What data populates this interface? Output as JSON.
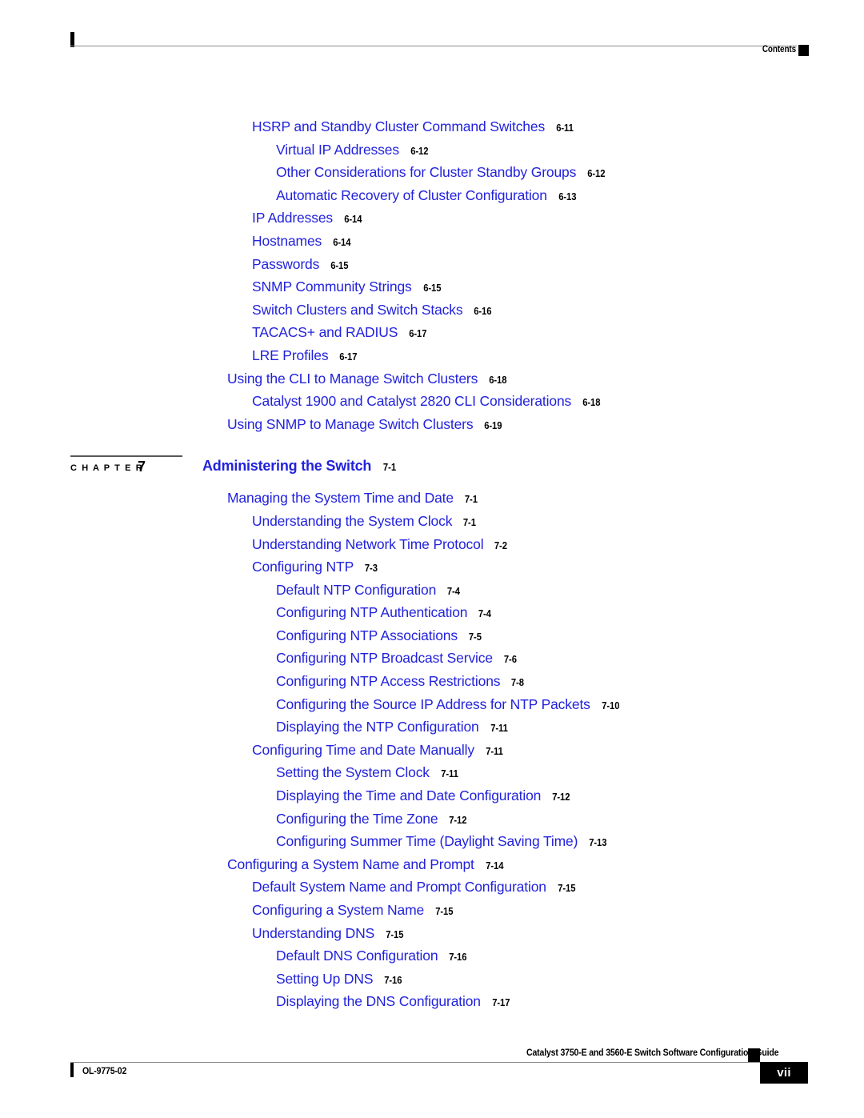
{
  "header": {
    "label": "Contents",
    "marker": "square-marker"
  },
  "toc": {
    "groups": [
      {
        "entries": [
          {
            "level": 2,
            "title": "HSRP and Standby Cluster Command Switches",
            "page": "6-11"
          },
          {
            "level": 3,
            "title": "Virtual IP Addresses",
            "page": "6-12"
          },
          {
            "level": 3,
            "title": "Other Considerations for Cluster Standby Groups",
            "page": "6-12"
          },
          {
            "level": 3,
            "title": "Automatic Recovery of Cluster Configuration",
            "page": "6-13"
          },
          {
            "level": 2,
            "title": "IP Addresses",
            "page": "6-14"
          },
          {
            "level": 2,
            "title": "Hostnames",
            "page": "6-14"
          },
          {
            "level": 2,
            "title": "Passwords",
            "page": "6-15"
          },
          {
            "level": 2,
            "title": "SNMP Community Strings",
            "page": "6-15"
          },
          {
            "level": 2,
            "title": "Switch Clusters and Switch Stacks",
            "page": "6-16"
          },
          {
            "level": 2,
            "title": "TACACS+ and RADIUS",
            "page": "6-17"
          },
          {
            "level": 2,
            "title": "LRE Profiles",
            "page": "6-17"
          },
          {
            "level": 1,
            "title": "Using the CLI to Manage Switch Clusters",
            "page": "6-18"
          },
          {
            "level": 2,
            "title": "Catalyst 1900 and Catalyst 2820 CLI Considerations",
            "page": "6-18"
          },
          {
            "level": 1,
            "title": "Using SNMP to Manage Switch Clusters",
            "page": "6-19"
          }
        ]
      }
    ]
  },
  "chapter": {
    "label": "C H A P T E R",
    "number": "7",
    "title": "Administering the Switch",
    "page": "7-1"
  },
  "toc_after_chapter": {
    "entries": [
      {
        "level": 1,
        "title": "Managing the System Time and Date",
        "page": "7-1"
      },
      {
        "level": 2,
        "title": "Understanding the System Clock",
        "page": "7-1"
      },
      {
        "level": 2,
        "title": "Understanding Network Time Protocol",
        "page": "7-2"
      },
      {
        "level": 2,
        "title": "Configuring NTP",
        "page": "7-3"
      },
      {
        "level": 3,
        "title": "Default NTP Configuration",
        "page": "7-4"
      },
      {
        "level": 3,
        "title": "Configuring NTP Authentication",
        "page": "7-4"
      },
      {
        "level": 3,
        "title": "Configuring NTP Associations",
        "page": "7-5"
      },
      {
        "level": 3,
        "title": "Configuring NTP Broadcast Service",
        "page": "7-6"
      },
      {
        "level": 3,
        "title": "Configuring NTP Access Restrictions",
        "page": "7-8"
      },
      {
        "level": 3,
        "title": "Configuring the Source IP Address for NTP Packets",
        "page": "7-10"
      },
      {
        "level": 3,
        "title": "Displaying the NTP Configuration",
        "page": "7-11"
      },
      {
        "level": 2,
        "title": "Configuring Time and Date Manually",
        "page": "7-11"
      },
      {
        "level": 3,
        "title": "Setting the System Clock",
        "page": "7-11"
      },
      {
        "level": 3,
        "title": "Displaying the Time and Date Configuration",
        "page": "7-12"
      },
      {
        "level": 3,
        "title": "Configuring the Time Zone",
        "page": "7-12"
      },
      {
        "level": 3,
        "title": "Configuring Summer Time (Daylight Saving Time)",
        "page": "7-13"
      },
      {
        "level": 1,
        "title": "Configuring a System Name and Prompt",
        "page": "7-14"
      },
      {
        "level": 2,
        "title": "Default System Name and Prompt Configuration",
        "page": "7-15"
      },
      {
        "level": 2,
        "title": "Configuring a System Name",
        "page": "7-15"
      },
      {
        "level": 2,
        "title": "Understanding DNS",
        "page": "7-15"
      },
      {
        "level": 3,
        "title": "Default DNS Configuration",
        "page": "7-16"
      },
      {
        "level": 3,
        "title": "Setting Up DNS",
        "page": "7-16"
      },
      {
        "level": 3,
        "title": "Displaying the DNS Configuration",
        "page": "7-17"
      }
    ]
  },
  "footer": {
    "doc_id": "OL-9775-02",
    "guide_title": "Catalyst 3750-E and 3560-E Switch Software Configuration Guide",
    "page_number": "vii",
    "marker": "square-marker"
  },
  "colors": {
    "link_blue": "#2222dd",
    "text_black": "#000000",
    "rule_gray": "#8a8a8a"
  }
}
